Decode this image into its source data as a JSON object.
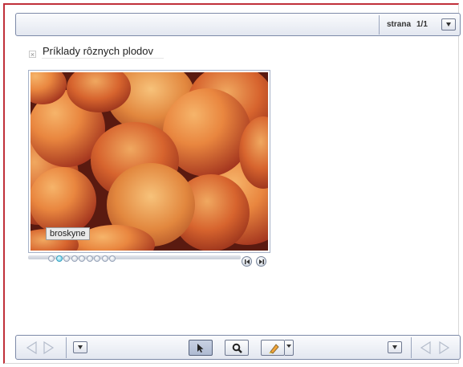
{
  "header": {
    "page_label": "strana",
    "page_number": "1/1",
    "menu_icon": "chevron-down-icon"
  },
  "slide": {
    "title": "Príklady rôznych plodov",
    "close_icon": "close-icon"
  },
  "gallery": {
    "image_subject": "peaches",
    "caption": "broskyne",
    "thumbnail_count": 9,
    "active_index": 1,
    "prev_icon": "previous-icon",
    "next_icon": "next-icon"
  },
  "footer": {
    "left_prev_icon": "arrow-left-icon",
    "left_next_icon": "arrow-right-icon",
    "left_menu_icon": "chevron-down-icon",
    "tools": [
      {
        "name": "pointer-tool",
        "icon": "cursor-icon",
        "active": true
      },
      {
        "name": "zoom-tool",
        "icon": "magnifier-icon",
        "active": false
      },
      {
        "name": "marker-tool",
        "icon": "highlighter-icon",
        "active": false
      }
    ],
    "right_menu_icon": "chevron-down-icon",
    "right_prev_icon": "arrow-left-icon",
    "right_next_icon": "arrow-right-icon"
  },
  "colors": {
    "frame_accent": "#c0303a",
    "toolbar_border": "#7d8aa8",
    "active_dot": "#59c9e6"
  }
}
